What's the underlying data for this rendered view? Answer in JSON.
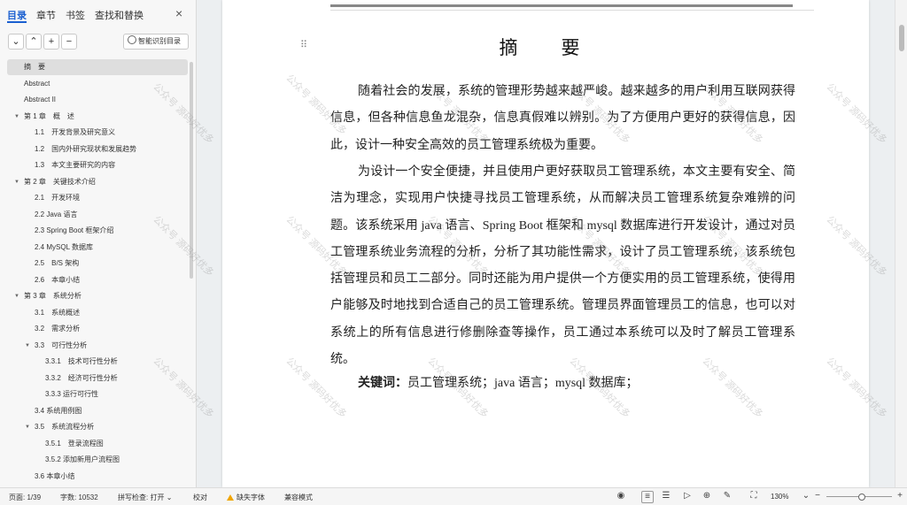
{
  "nav": {
    "tabs": [
      {
        "label": "目录",
        "active": true
      },
      {
        "label": "章节"
      },
      {
        "label": "书签"
      },
      {
        "label": "查找和替换"
      }
    ],
    "close_icon": "×",
    "toolbar": {
      "collapse": "⌄",
      "expand": "⌃",
      "add": "+",
      "remove": "−",
      "smart_label": "智能识别目录"
    },
    "toc": [
      {
        "label": "摘　要",
        "level": 1,
        "selected": true
      },
      {
        "label": "Abstract",
        "level": 1
      },
      {
        "label": "Abstract II",
        "level": 1
      },
      {
        "label": "第 1 章　概　述",
        "level": 1,
        "expandable": true
      },
      {
        "label": "1.1　开发背景及研究意义",
        "level": 2
      },
      {
        "label": "1.2　国内外研究现状和发展趋势",
        "level": 2
      },
      {
        "label": "1.3　本文主要研究的内容",
        "level": 2
      },
      {
        "label": "第 2 章　关键技术介绍",
        "level": 1,
        "expandable": true
      },
      {
        "label": "2.1　开发环境",
        "level": 2
      },
      {
        "label": "2.2 Java 语言",
        "level": 2
      },
      {
        "label": "2.3 Spring Boot 框架介绍",
        "level": 2
      },
      {
        "label": "2.4 MySQL 数据库",
        "level": 2
      },
      {
        "label": "2.5　B/S 架构",
        "level": 2
      },
      {
        "label": "2.6　本章小结",
        "level": 2
      },
      {
        "label": "第 3 章　系统分析",
        "level": 1,
        "expandable": true
      },
      {
        "label": "3.1　系统概述",
        "level": 2
      },
      {
        "label": "3.2　需求分析",
        "level": 2
      },
      {
        "label": "3.3　可行性分析",
        "level": 2,
        "expandable": true
      },
      {
        "label": "3.3.1　技术可行性分析",
        "level": 3
      },
      {
        "label": "3.3.2　经济可行性分析",
        "level": 3
      },
      {
        "label": "3.3.3 运行可行性",
        "level": 3
      },
      {
        "label": "3.4 系统用例图",
        "level": 2
      },
      {
        "label": "3.5　系统流程分析",
        "level": 2,
        "expandable": true
      },
      {
        "label": "3.5.1　登录流程图",
        "level": 3
      },
      {
        "label": "3.5.2 添加新用户流程图",
        "level": 3
      },
      {
        "label": "3.6 本章小结",
        "level": 2
      }
    ]
  },
  "document": {
    "title": "摘　要",
    "paragraphs": [
      "随着社会的发展，系统的管理形势越来越严峻。越来越多的用户利用互联网获得信息，但各种信息鱼龙混杂，信息真假难以辨别。为了方便用户更好的获得信息，因此，设计一种安全高效的员工管理系统极为重要。",
      "为设计一个安全便捷，并且使用户更好获取员工管理系统，本文主要有安全、简洁为理念，实现用户快捷寻找员工管理系统，从而解决员工管理系统复杂难辨的问题。该系统采用 java 语言、Spring Boot 框架和 mysql 数据库进行开发设计，通过对员工管理系统业务流程的分析，分析了其功能性需求，设计了员工管理系统，该系统包括管理员和员工二部分。同时还能为用户提供一个方便实用的员工管理系统，使得用户能够及时地找到合适自己的员工管理系统。管理员界面管理员工的信息，也可以对系统上的所有信息进行修删除查等操作，员工通过本系统可以及时了解员工管理系统。"
    ],
    "keywords_label": "关键词：",
    "keywords_value": "员工管理系统；java 语言；mysql 数据库；",
    "watermark": "公众号 源码好优多"
  },
  "status": {
    "page": "页面: 1/39",
    "words": "字数: 10532",
    "spellcheck": "拼写检查: 打开",
    "proofread": "校对",
    "missing_font": "缺失字体",
    "compat": "兼容模式",
    "zoom": "130%",
    "zoom_level": 0.53
  }
}
